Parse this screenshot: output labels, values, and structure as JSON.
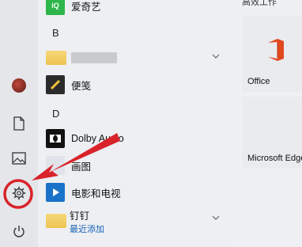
{
  "start_menu": {
    "rail": {
      "items": [
        {
          "name": "user-avatar"
        },
        {
          "name": "documents"
        },
        {
          "name": "pictures"
        },
        {
          "name": "settings"
        },
        {
          "name": "power"
        }
      ]
    },
    "app_list": {
      "top_app": {
        "label": "爱奇艺",
        "icon": "iqiyi-icon"
      },
      "groups": [
        {
          "letter": "B"
        },
        {
          "letter": "D"
        }
      ],
      "blurred_folder": {
        "label": ""
      },
      "bianjian": {
        "label": "便笺"
      },
      "dolby": {
        "label": "Dolby Audio"
      },
      "paint": {
        "label": "画图"
      },
      "movies": {
        "label": "电影和电视"
      },
      "dingding": {
        "label": "钉钉",
        "sublabel": "最近添加"
      }
    },
    "tiles": {
      "header": "高效工作",
      "office": {
        "label": "Office"
      },
      "edge": {
        "label": "Microsoft Edge"
      }
    }
  },
  "colors": {
    "accent_red": "#d9232a",
    "office_orange": "#e2491f",
    "link_blue": "#1a63b8",
    "iqiyi_green": "#2fb64a"
  }
}
